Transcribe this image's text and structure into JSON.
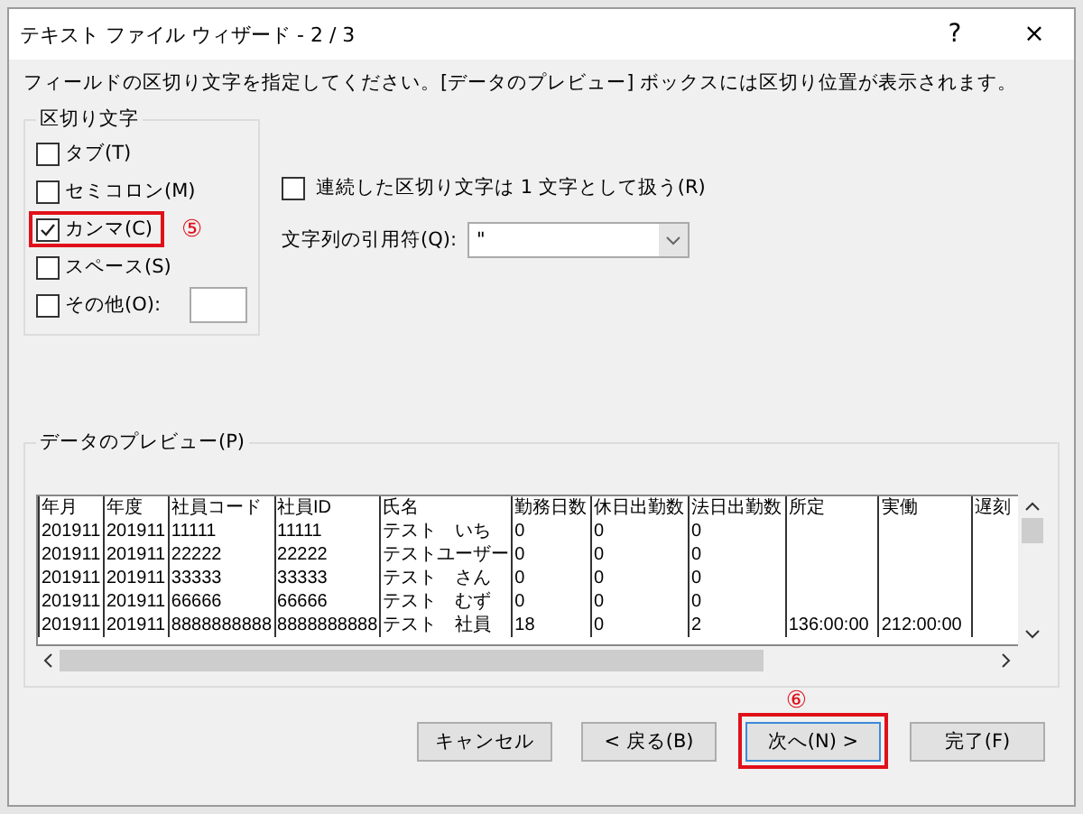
{
  "window": {
    "title": "テキスト ファイル ウィザード - 2 / 3",
    "help": "?",
    "close": "×"
  },
  "instruction": "フィールドの区切り文字を指定してください。[データのプレビュー] ボックスには区切り位置が表示されます。",
  "delimiters": {
    "title": "区切り文字",
    "items": [
      {
        "kind": "check",
        "label": "タブ(T)",
        "checked": false,
        "highlighted": false
      },
      {
        "kind": "check",
        "label": "セミコロン(M)",
        "checked": false,
        "highlighted": false
      },
      {
        "kind": "check",
        "label": "カンマ(C)",
        "checked": true,
        "highlighted": true,
        "annotation": "⑤"
      },
      {
        "kind": "check",
        "label": "スペース(S)",
        "checked": false,
        "highlighted": false
      },
      {
        "kind": "other",
        "label": "その他(O):",
        "checked": false,
        "highlighted": false
      }
    ]
  },
  "consecutive": {
    "label": "連続した区切り文字は 1 文字として扱う(R)",
    "checked": false
  },
  "qualifier": {
    "label": "文字列の引用符(Q):",
    "value": "\""
  },
  "preview": {
    "title": "データのプレビュー(P)",
    "columns": [
      "年月",
      "年度",
      "社員コード",
      "社員ID",
      "氏名",
      "勤務日数",
      "休日出勤数",
      "法日出勤数",
      "所定",
      "実働",
      "遅刻"
    ],
    "rows": [
      [
        "201911",
        "201911",
        "11111",
        "11111",
        "テスト　いち",
        "0",
        "0",
        "0"
      ],
      [
        "201911",
        "201911",
        "22222",
        "22222",
        "テストユーザー",
        "0",
        "0",
        "0"
      ],
      [
        "201911",
        "201911",
        "33333",
        "33333",
        "テスト　さん",
        "0",
        "0",
        "0"
      ],
      [
        "201911",
        "201911",
        "66666",
        "66666",
        "テスト　むず",
        "0",
        "0",
        "0"
      ],
      [
        "201911",
        "201911",
        "8888888888",
        "8888888888",
        "テスト　社員",
        "18",
        "0",
        "2",
        "136:00:00",
        "212:00:00"
      ]
    ]
  },
  "annotation": "⑥",
  "buttons": [
    {
      "label": "キャンセル",
      "highlighted": false,
      "focused": false
    },
    {
      "label": "< 戻る(B)",
      "highlighted": false,
      "focused": false
    },
    {
      "label": "次へ(N) >",
      "highlighted": true,
      "focused": true
    },
    {
      "label": "完了(F)",
      "highlighted": false,
      "focused": false
    }
  ]
}
